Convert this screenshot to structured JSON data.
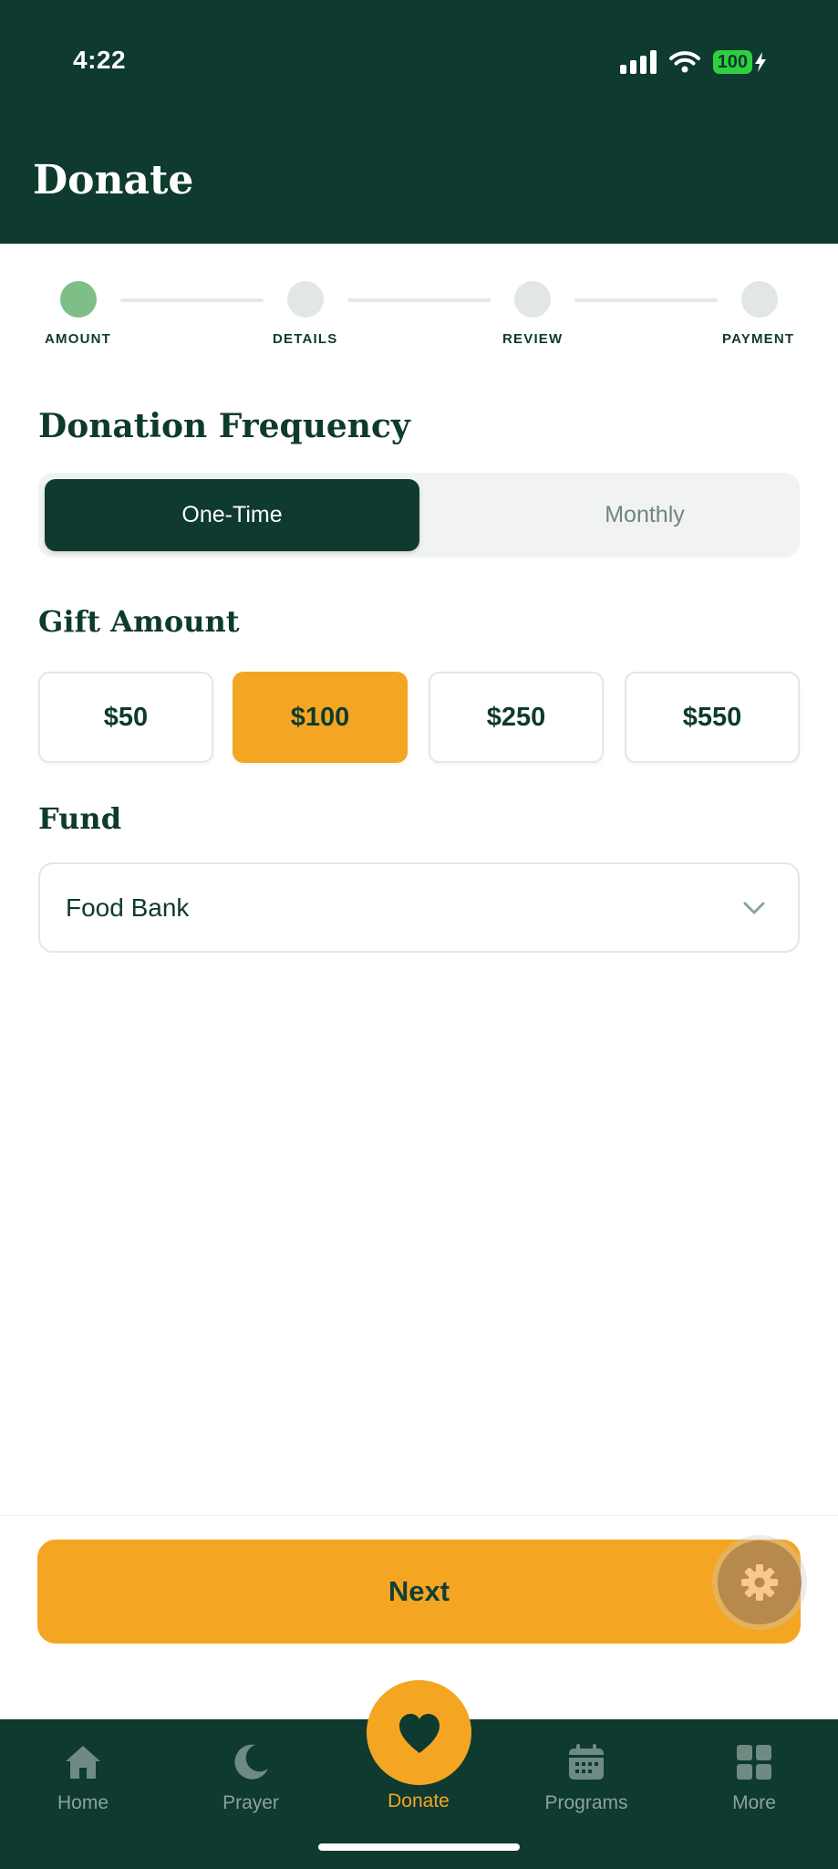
{
  "status_bar": {
    "time": "4:22",
    "battery": "100"
  },
  "header": {
    "title": "Donate"
  },
  "stepper": {
    "steps": [
      {
        "label": "AMOUNT",
        "active": true
      },
      {
        "label": "DETAILS",
        "active": false
      },
      {
        "label": "REVIEW",
        "active": false
      },
      {
        "label": "PAYMENT",
        "active": false
      }
    ]
  },
  "frequency": {
    "title": "Donation Frequency",
    "options": [
      "One-Time",
      "Monthly"
    ],
    "selected": "One-Time"
  },
  "gift": {
    "title": "Gift Amount",
    "amounts": [
      "$50",
      "$100",
      "$250",
      "$550"
    ],
    "selected": "$100"
  },
  "fund": {
    "title": "Fund",
    "selected": "Food Bank"
  },
  "actions": {
    "next_label": "Next"
  },
  "nav": {
    "items": [
      {
        "label": "Home",
        "icon": "home-icon"
      },
      {
        "label": "Prayer",
        "icon": "moon-icon"
      },
      {
        "label": "Donate",
        "icon": "heart-icon"
      },
      {
        "label": "Programs",
        "icon": "calendar-icon"
      },
      {
        "label": "More",
        "icon": "grid-icon"
      }
    ]
  },
  "colors": {
    "brand_dark": "#0e3a2f",
    "accent": "#f4a623",
    "step_active": "#7fbf87"
  }
}
